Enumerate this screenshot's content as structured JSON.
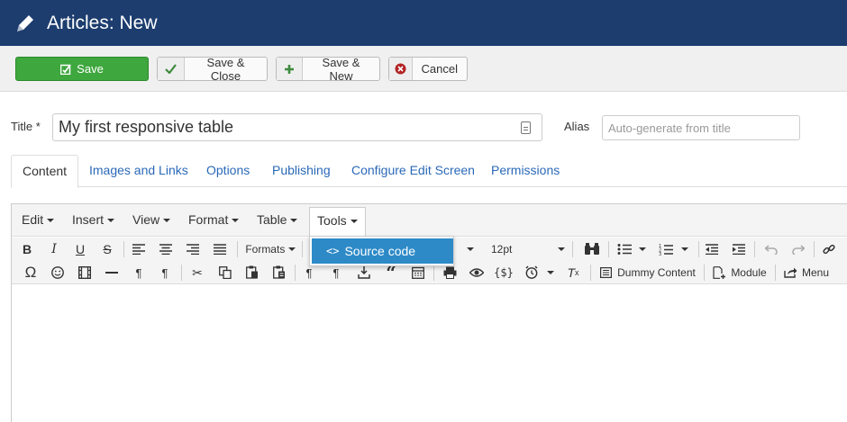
{
  "header": {
    "title": "Articles: New"
  },
  "toolbar": {
    "save": "Save",
    "save_close": "Save & Close",
    "save_new": "Save & New",
    "cancel": "Cancel"
  },
  "form": {
    "title_label": "Title *",
    "title_value": "My first responsive table",
    "alias_label": "Alias",
    "alias_placeholder": "Auto-generate from title"
  },
  "tabs": [
    "Content",
    "Images and Links",
    "Options",
    "Publishing",
    "Configure Edit Screen",
    "Permissions"
  ],
  "editor": {
    "menus": [
      "Edit",
      "Insert",
      "View",
      "Format",
      "Table",
      "Tools"
    ],
    "formats_label": "Formats",
    "font_size": "12pt",
    "dummy_content": "Dummy Content",
    "module": "Module",
    "menu": "Menu",
    "source_code_glyph": "<>",
    "var_glyph": "{$}"
  },
  "tools_dropdown": {
    "item": "Source code"
  },
  "colors": {
    "header": "#1c3d6e",
    "save": "#3ea73e",
    "link": "#2a69b8",
    "dropdown_active": "#2d8ac7"
  }
}
